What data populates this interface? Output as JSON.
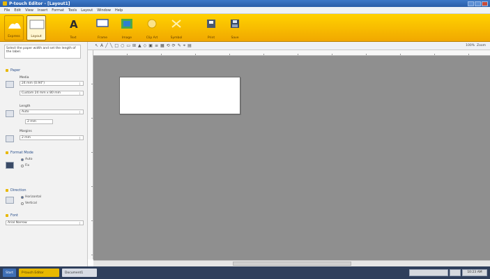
{
  "window": {
    "title": "P-touch Editor - [Layout1]"
  },
  "menu": [
    "File",
    "Edit",
    "View",
    "Insert",
    "Format",
    "Tools",
    "Layout",
    "Window",
    "Help"
  ],
  "ribbon": {
    "modes": [
      {
        "label": "Express"
      },
      {
        "label": "Layout"
      }
    ],
    "buttons": [
      {
        "label": "Text",
        "icon": "text-icon"
      },
      {
        "label": "Frame",
        "icon": "frame-icon"
      },
      {
        "label": "Image",
        "icon": "image-icon"
      },
      {
        "label": "Clip Art",
        "icon": "clipart-icon"
      },
      {
        "label": "Symbol",
        "icon": "symbol-icon"
      },
      {
        "label": "Print",
        "icon": "print-icon"
      },
      {
        "label": "Save",
        "icon": "save-icon"
      }
    ]
  },
  "sidebar": {
    "hint": "Select the paper width and set the length of the label.",
    "paper_heading": "Paper",
    "media_label": "Media",
    "media_value": "24 mm (0.94\")",
    "size_value": "Custom 24 mm x 80 mm",
    "length_label": "Length",
    "length_value": "Auto",
    "margin_label": "Margins",
    "margin_value": "2 mm",
    "orientation_heading": "Format Mode",
    "orient_1": "Auto",
    "orient_2": "Fix",
    "text_heading": "Direction",
    "text_opt_1": "Horizontal",
    "text_opt_2": "Vertical",
    "font_heading": "Font",
    "font_value": "Arial Narrow"
  },
  "toolbar2": {
    "tools": [
      "↖",
      "A",
      "╱",
      "╲",
      "□",
      "○",
      "▭",
      "⊞",
      "▲",
      "◇",
      "▣",
      "≡",
      "▦",
      "⟲",
      "⟳",
      "✎",
      "⌖",
      "▤"
    ],
    "zoom_value": "100%",
    "zoom_label": "Zoom"
  },
  "statusbar": {
    "start": "Start",
    "task1": "P-touch Editor",
    "task2": "Document1",
    "tray_time": "10:23 AM"
  }
}
